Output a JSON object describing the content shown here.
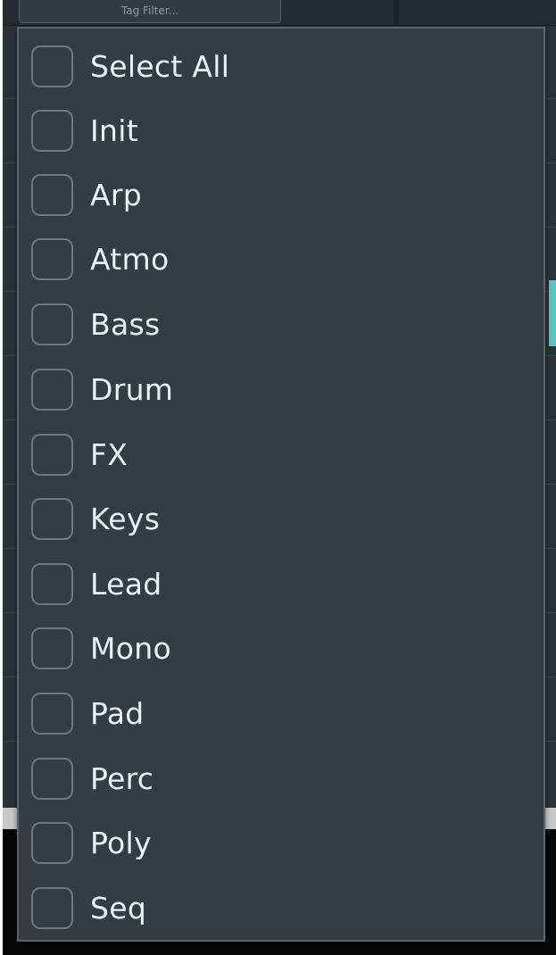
{
  "background": {
    "tag_filter_placeholder": "Tag Filter..."
  },
  "dropdown": {
    "options": [
      {
        "label": "Select All",
        "checked": false
      },
      {
        "label": "Init",
        "checked": false
      },
      {
        "label": "Arp",
        "checked": false
      },
      {
        "label": "Atmo",
        "checked": false
      },
      {
        "label": "Bass",
        "checked": false
      },
      {
        "label": "Drum",
        "checked": false
      },
      {
        "label": "FX",
        "checked": false
      },
      {
        "label": "Keys",
        "checked": false
      },
      {
        "label": "Lead",
        "checked": false
      },
      {
        "label": "Mono",
        "checked": false
      },
      {
        "label": "Pad",
        "checked": false
      },
      {
        "label": "Perc",
        "checked": false
      },
      {
        "label": "Poly",
        "checked": false
      },
      {
        "label": "Seq",
        "checked": false
      }
    ]
  },
  "colors": {
    "panel_background": "#353d42",
    "panel_border": "#5a646b",
    "checkbox_border": "#6d787f",
    "label_text": "#eef1f2",
    "accent_teal": "#5fc3c3"
  }
}
